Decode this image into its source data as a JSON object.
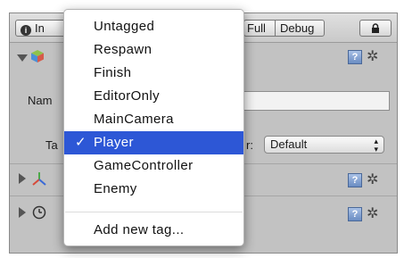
{
  "toolbar": {
    "inspector_tab": "In",
    "normal_label": "Full",
    "debug_label": "Debug"
  },
  "object": {
    "name_label": "Nam",
    "tag_label": "Ta",
    "layer_label": "r:",
    "layer_value": "Default"
  },
  "tag_menu": {
    "items": [
      {
        "label": "Untagged",
        "checked": false
      },
      {
        "label": "Respawn",
        "checked": false
      },
      {
        "label": "Finish",
        "checked": false
      },
      {
        "label": "EditorOnly",
        "checked": false
      },
      {
        "label": "MainCamera",
        "checked": false
      },
      {
        "label": "Player",
        "checked": true
      },
      {
        "label": "GameController",
        "checked": false
      },
      {
        "label": "Enemy",
        "checked": false
      }
    ],
    "check_mark": "✓",
    "add_new": "Add new tag..."
  },
  "icons": {
    "help": "?",
    "gear": "✲",
    "lock": "lock-icon",
    "info": "i"
  },
  "colors": {
    "selection": "#2d57d6",
    "panel": "#c2c2c2"
  }
}
